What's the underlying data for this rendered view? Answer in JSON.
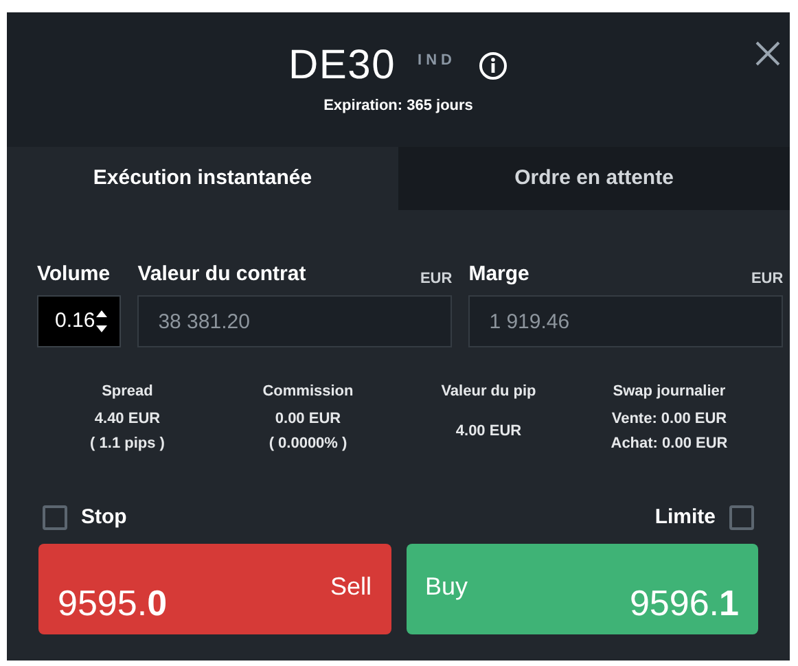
{
  "header": {
    "symbol": "DE30",
    "category": "IND",
    "expiration": "Expiration: 365 jours"
  },
  "tabs": [
    {
      "label": "Exécution instantanée",
      "selected": true
    },
    {
      "label": "Ordre en attente",
      "selected": false
    }
  ],
  "fields": [
    {
      "kind": "spinner",
      "label": "Volume",
      "value": "0.16"
    },
    {
      "kind": "readonly",
      "label": "Valeur du contrat",
      "unit": "EUR",
      "value": "38 381.20"
    },
    {
      "kind": "readonly",
      "label": "Marge",
      "unit": "EUR",
      "value": "1 919.46"
    }
  ],
  "stats": [
    {
      "label": "Spread",
      "lines": [
        "4.40 EUR",
        "( 1.1 pips )"
      ]
    },
    {
      "label": "Commission",
      "lines": [
        "0.00 EUR",
        "( 0.0000% )"
      ]
    },
    {
      "label": "Valeur du pip",
      "lines": [
        "4.00 EUR"
      ]
    },
    {
      "label": "Swap journalier",
      "lines": [
        "Vente: 0.00 EUR",
        "Achat: 0.00 EUR"
      ]
    }
  ],
  "options": [
    {
      "label": "Stop",
      "checked": false
    },
    {
      "label": "Limite",
      "checked": false
    }
  ],
  "orders": [
    {
      "kind": "sell",
      "label": "Sell",
      "price": "9595.**0**"
    },
    {
      "kind": "buy",
      "label": "Buy",
      "price": "9596.**1**"
    }
  ]
}
